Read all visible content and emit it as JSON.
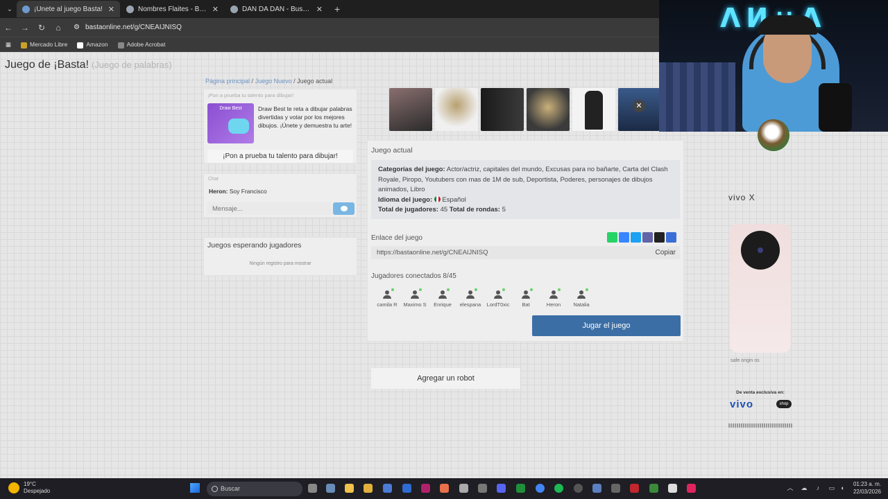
{
  "browser": {
    "tabs": [
      {
        "title": "¡Únete al juego Basta!",
        "active": true
      },
      {
        "title": "Nombres Flaites - Buscar con G",
        "active": false
      },
      {
        "title": "DAN DA DAN - Buscar con Goo",
        "active": false
      }
    ],
    "url": "bastaonline.net/g/CNEAIJNISQ",
    "bookmarks": [
      "Mercado Libre",
      "Amazon",
      "Adobe Acrobat"
    ]
  },
  "page": {
    "title": "Juego de ¡Basta!",
    "subtitle": "(Juego de palabras)",
    "breadcrumb": [
      "Página principal",
      "Juego Nuevo",
      "Juego actual"
    ],
    "promo": {
      "header": "¡Pon a prueba tu talento para dibujar!",
      "image_label": "Draw Best",
      "text": "Draw Best te reta a dibujar palabras divertidas y votar por los mejores dibujos. ¡Únete y demuestra tu arte!",
      "button": "¡Pon a prueba tu talento para dibujar!"
    },
    "chat": {
      "header": "Chat",
      "message_user": "Heron:",
      "message_text": "Soy Francisco",
      "placeholder": "Mensaje..."
    },
    "waiting": {
      "title": "Juegos esperando jugadores",
      "empty": "Ningún registro para mostrar"
    },
    "game": {
      "header": "Juego actual",
      "categories_label": "Categorías del juego:",
      "categories": "Actor/actriz, capitales del mundo, Excusas para no bañarte, Carta del Clash Royale, Piropo, Youtubers con mas de 1M de sub, Deportista, Poderes, personajes de dibujos animados, Libro",
      "language_label": "Idioma del juego:",
      "language": "Español",
      "players_label": "Total de jugadores:",
      "players_total": "45",
      "rounds_label": "Total de rondas:",
      "rounds_total": "5",
      "link_label": "Enlace del juego",
      "link": "https://bastaonline.net/g/CNEAIJNISQ",
      "copy": "Copiar",
      "connected_label": "Jugadores conectados 8/45",
      "players": [
        "camila R",
        "Maximo S",
        "Enrique",
        "elespana",
        "LordT0xic",
        "Bat",
        "Heron",
        "Natalia"
      ],
      "robot_button": "Agregar un robot",
      "play_button": "Jugar el juego"
    },
    "ad": {
      "brand": "vivo X",
      "exclusive": "De venta exclusiva en:",
      "store": "vivo",
      "shop": "shop",
      "logos": "safe  origin os"
    }
  },
  "taskbar": {
    "temp": "19°C",
    "weather": "Despejado",
    "search": "Buscar",
    "time": "01:23 a. m.",
    "date": "22/03/2026"
  },
  "colors": {
    "play": "#3b6ea5",
    "link": "#6a93c4"
  }
}
